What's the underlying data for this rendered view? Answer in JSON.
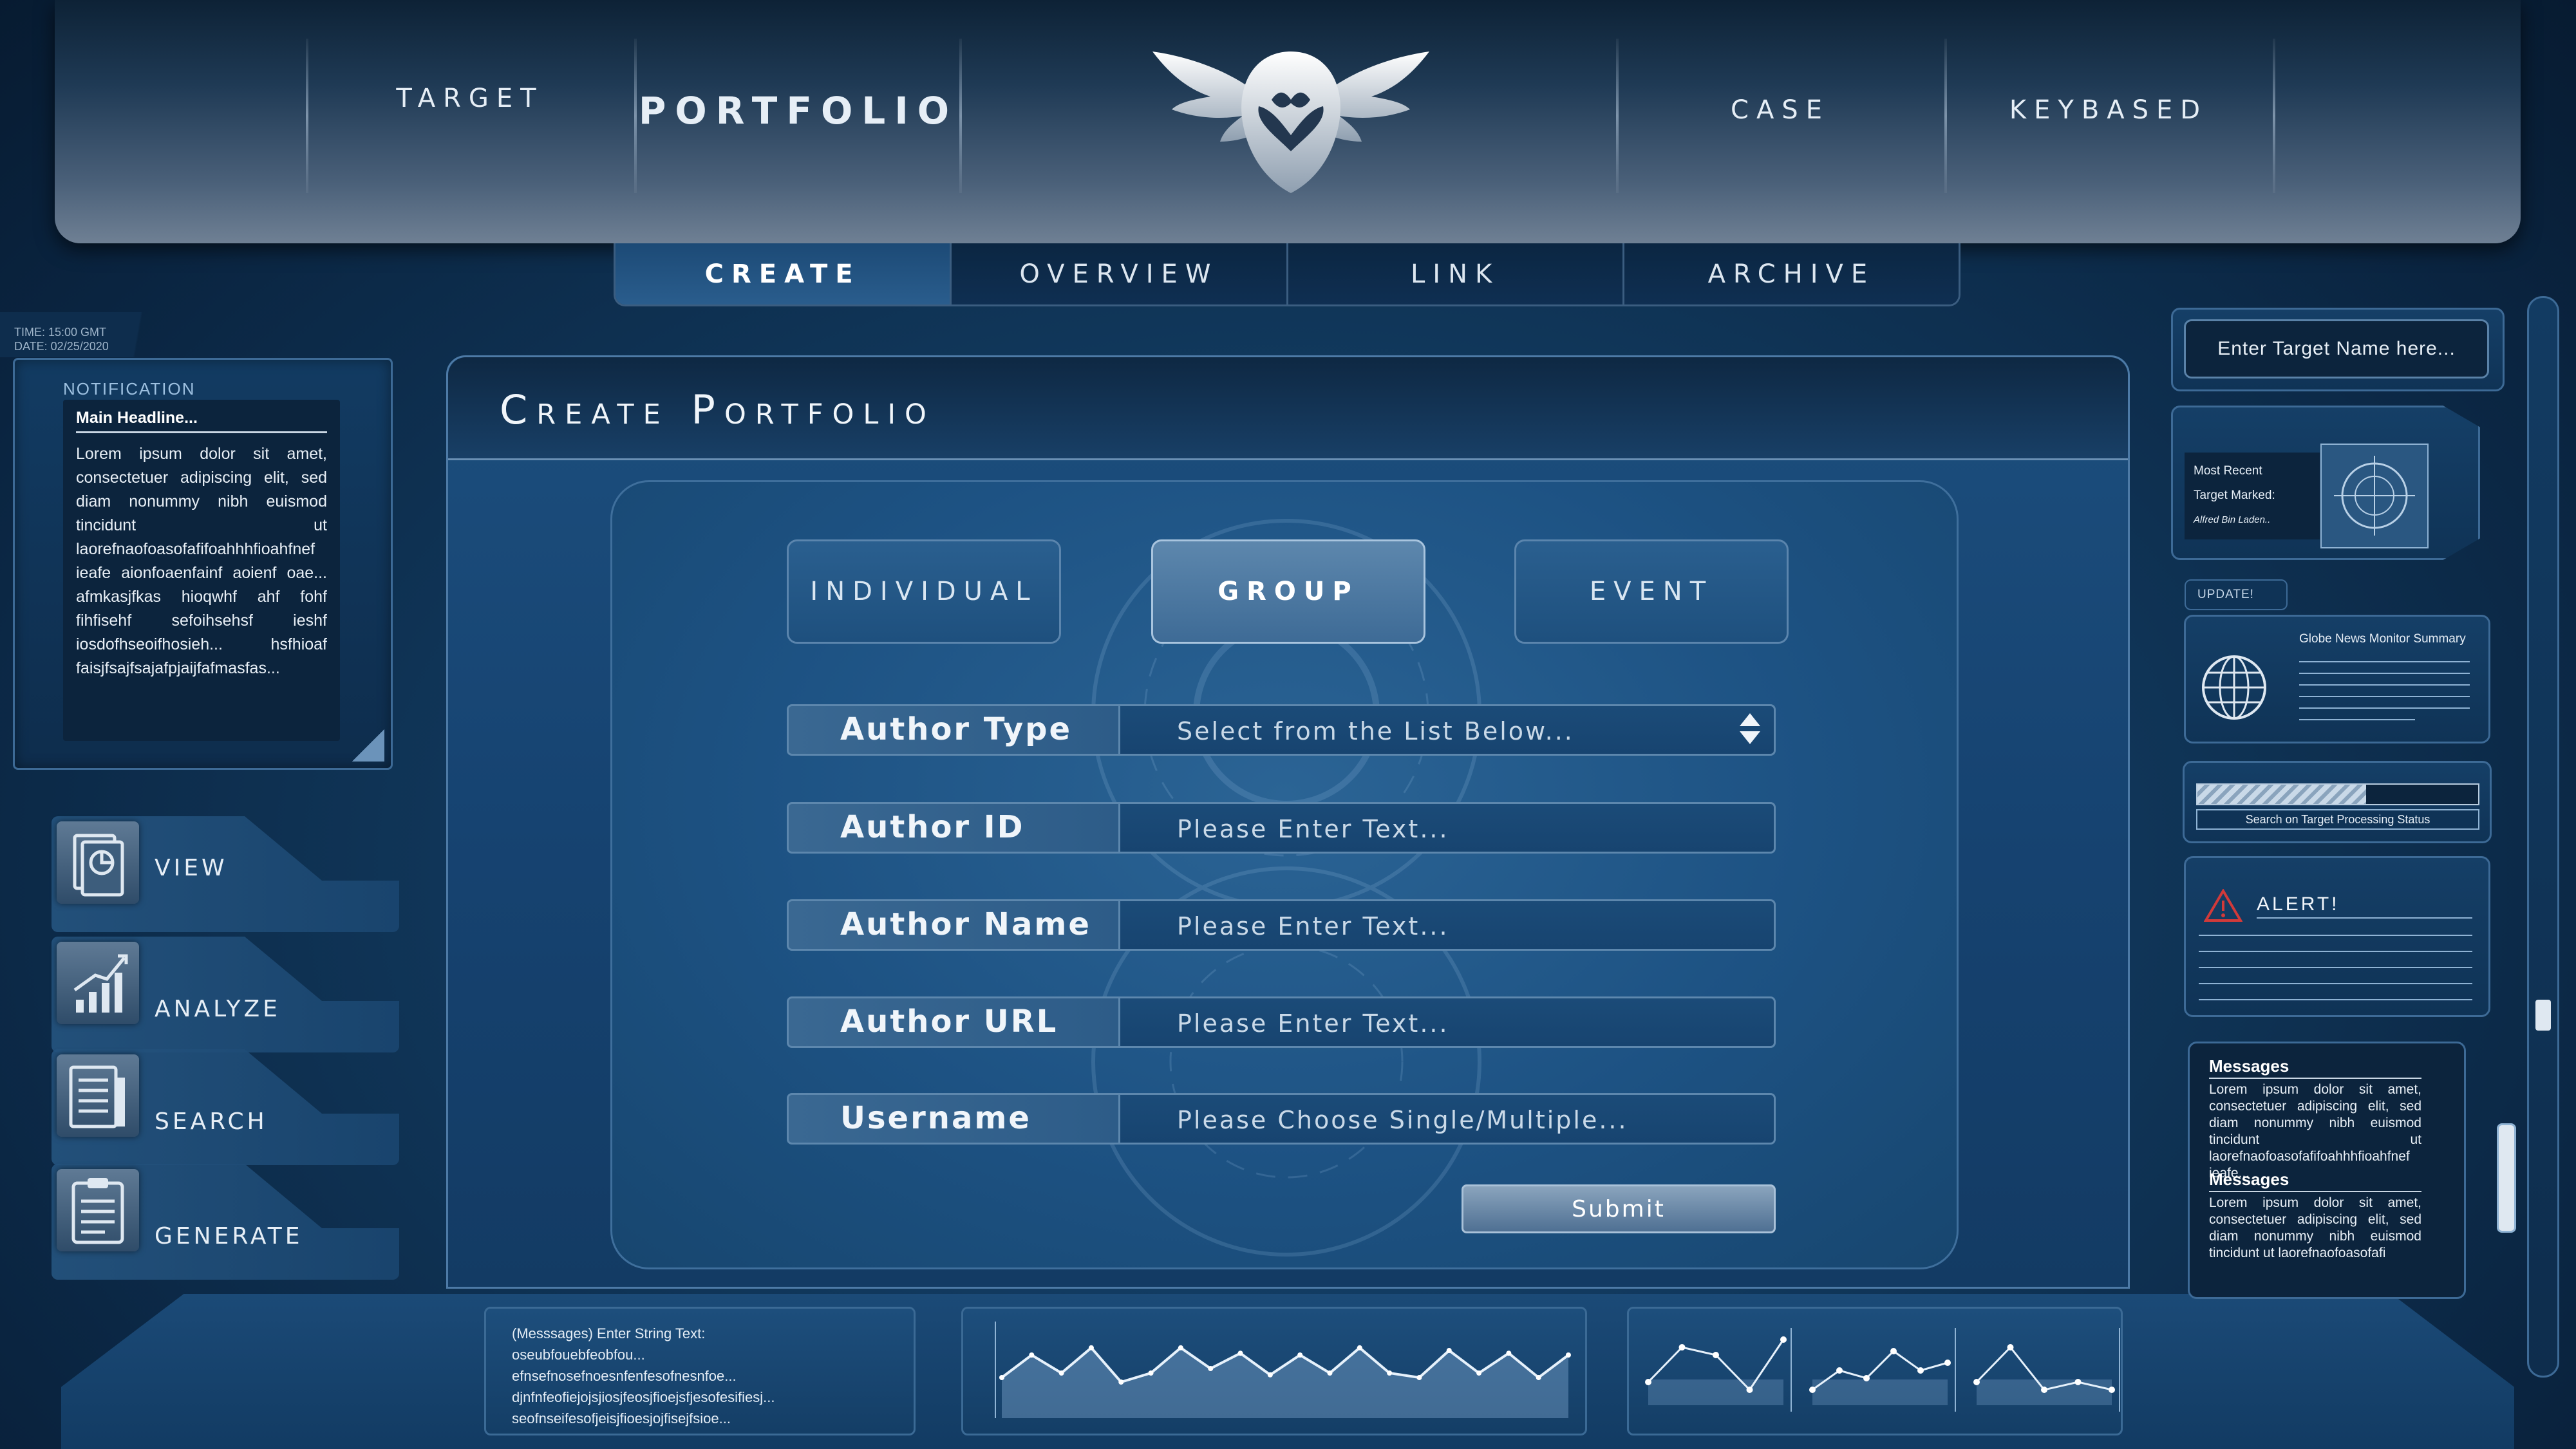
{
  "header": {
    "nav_left": [
      "TARGET",
      "PORTFOLIO"
    ],
    "nav_right": [
      "CASE",
      "KEYBASED"
    ]
  },
  "subtabs": [
    "CREATE",
    "OVERVIEW",
    "LINK",
    "ARCHIVE"
  ],
  "status": {
    "time": "TIME: 15:00 GMT",
    "date": "DATE: 02/25/2020"
  },
  "notification": {
    "label": "NOTIFICATION",
    "headline": "Main Headline...",
    "body": "Lorem ipsum dolor sit amet, consectetuer adipiscing elit, sed diam nonummy nibh euismod tincidunt ut laorefnaofoasofafifoahhhfioahfnef ieafe aionfoaenfainf aoienf oae... afmkasjfkas hioqwhf ahf fohf fihfisehf sefoihsehsf ieshf iosdofhseoifhosieh... hsfhioaf faisjfsajfsajafpjaijfafmasfas..."
  },
  "sidebar": [
    {
      "label": "VIEW",
      "icon": "view-report-icon"
    },
    {
      "label": "ANALYZE",
      "icon": "analyze-chart-icon"
    },
    {
      "label": "SEARCH",
      "icon": "search-document-icon"
    },
    {
      "label": "GENERATE",
      "icon": "generate-clipboard-icon"
    }
  ],
  "main": {
    "title": "Create Portfolio",
    "type_buttons": [
      "INDIVIDUAL",
      "GROUP",
      "EVENT"
    ],
    "active_type": "GROUP",
    "fields": [
      {
        "label": "Author Type",
        "placeholder": "Select from the List Below...",
        "kind": "select"
      },
      {
        "label": "Author ID",
        "placeholder": "Please Enter Text...",
        "kind": "text"
      },
      {
        "label": "Author Name",
        "placeholder": "Please Enter Text...",
        "kind": "text"
      },
      {
        "label": "Author URL",
        "placeholder": "Please Enter Text...",
        "kind": "text"
      },
      {
        "label": "Username",
        "placeholder": "Please Choose Single/Multiple...",
        "kind": "text"
      }
    ],
    "submit": "Submit"
  },
  "bottom": {
    "messages": [
      "(Messsages) Enter String Text:",
      "oseubfouebfeobfou...",
      "efnsefnosefnoesnfenfesofnesnfoe...",
      "djnfnfeofiejojsjiosjfeosjfioejsfjesofesifiesj...",
      "seofnseifesofjeisjfioesjojfisejfsioe..."
    ],
    "line_chart": [
      0.45,
      0.7,
      0.5,
      0.78,
      0.4,
      0.5,
      0.78,
      0.55,
      0.72,
      0.48,
      0.7,
      0.5,
      0.78,
      0.5,
      0.45,
      0.75,
      0.5,
      0.72,
      0.45,
      0.7
    ],
    "mini_charts": [
      [
        0.3,
        0.75,
        0.65,
        0.2,
        0.85
      ],
      [
        0.2,
        0.45,
        0.35,
        0.7,
        0.45,
        0.55
      ],
      [
        0.3,
        0.75,
        0.2,
        0.3,
        0.2
      ]
    ]
  },
  "right": {
    "target_placeholder": "Enter Target Name here...",
    "recent": {
      "line1": "Most Recent",
      "line2": "Target Marked:",
      "line3": "Alfred Bin Laden.."
    },
    "update_label": "UPDATE!",
    "globe_title": "Globe News Monitor Summary",
    "status_label": "Search on Target Processing Status",
    "status_progress": 0.6,
    "alert_label": "ALERT!",
    "messages": [
      {
        "title": "Messages",
        "body": "Lorem ipsum dolor sit amet, consectetuer adipiscing elit, sed diam nonummy nibh euismod tincidunt ut laorefnaofoasofafifoahhhfioahfnef ieafe..."
      },
      {
        "title": "Messages",
        "body": "Lorem ipsum dolor sit amet, consectetuer adipiscing elit, sed diam nonummy nibh euismod tincidunt ut laorefnaofoasofafi"
      }
    ]
  },
  "colors": {
    "accent": "#2a5d8d",
    "panel": "#164371",
    "text": "#dbe7f3"
  }
}
